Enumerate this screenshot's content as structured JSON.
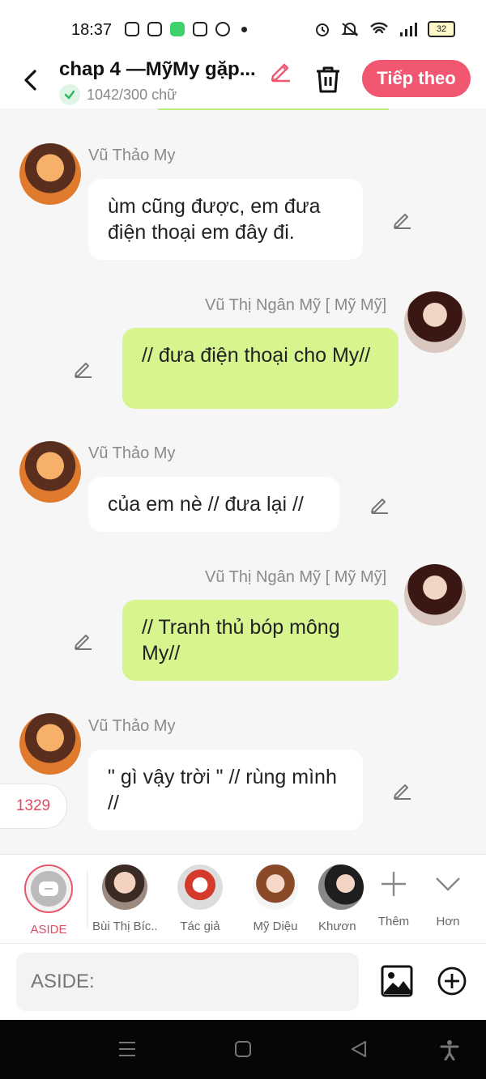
{
  "status": {
    "time": "18:37",
    "battery": "32"
  },
  "header": {
    "title": "chap 4 —MỹMy gặp...",
    "word_count": "1042/300 chữ",
    "next_label": "Tiếp theo"
  },
  "messages": [
    {
      "sender": "Vũ Thảo My",
      "text": "ùm cũng được, em đưa điện thoại em đây đi."
    },
    {
      "sender": "Vũ Thị Ngân Mỹ [ Mỹ Mỹ]",
      "text": "// đưa điện thoại cho My//"
    },
    {
      "sender": "Vũ Thảo My",
      "text": "của em nè // đưa lại //"
    },
    {
      "sender": "Vũ Thị Ngân Mỹ [ Mỹ Mỹ]",
      "text": "// Tranh thủ bóp mông My//"
    },
    {
      "sender": "Vũ Thảo My",
      "text": "\" gì vậy trời \" // rùng mình //"
    }
  ],
  "count_badge": "1329",
  "characters": [
    {
      "label": "ASIDE"
    },
    {
      "label": "Bùi Thị Bíc..."
    },
    {
      "label": "Tác giả"
    },
    {
      "label": "Mỹ Diệu"
    },
    {
      "label": "Khươn"
    }
  ],
  "more_add_label": "Thêm",
  "more_label": "Hơn",
  "input": {
    "placeholder": "ASIDE:"
  }
}
